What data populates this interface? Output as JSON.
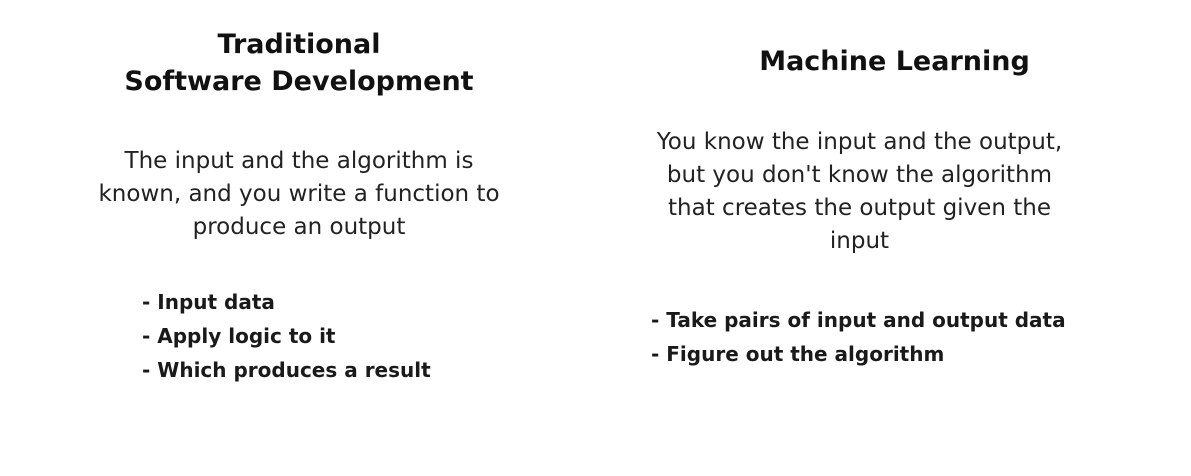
{
  "left": {
    "heading": [
      "Traditional",
      "Software Development"
    ],
    "description": [
      "The input and the algorithm is",
      "known, and you write a function to",
      "produce an output"
    ],
    "bullets": [
      "- Input data",
      "- Apply logic to it",
      "- Which produces a result"
    ]
  },
  "right": {
    "heading": [
      "Machine Learning"
    ],
    "description": [
      "You know the input and the output,",
      "but you don't know the algorithm",
      "that creates the output given the",
      "input"
    ],
    "bullets": [
      "- Take pairs of input and output data",
      "- Figure out the algorithm"
    ]
  }
}
